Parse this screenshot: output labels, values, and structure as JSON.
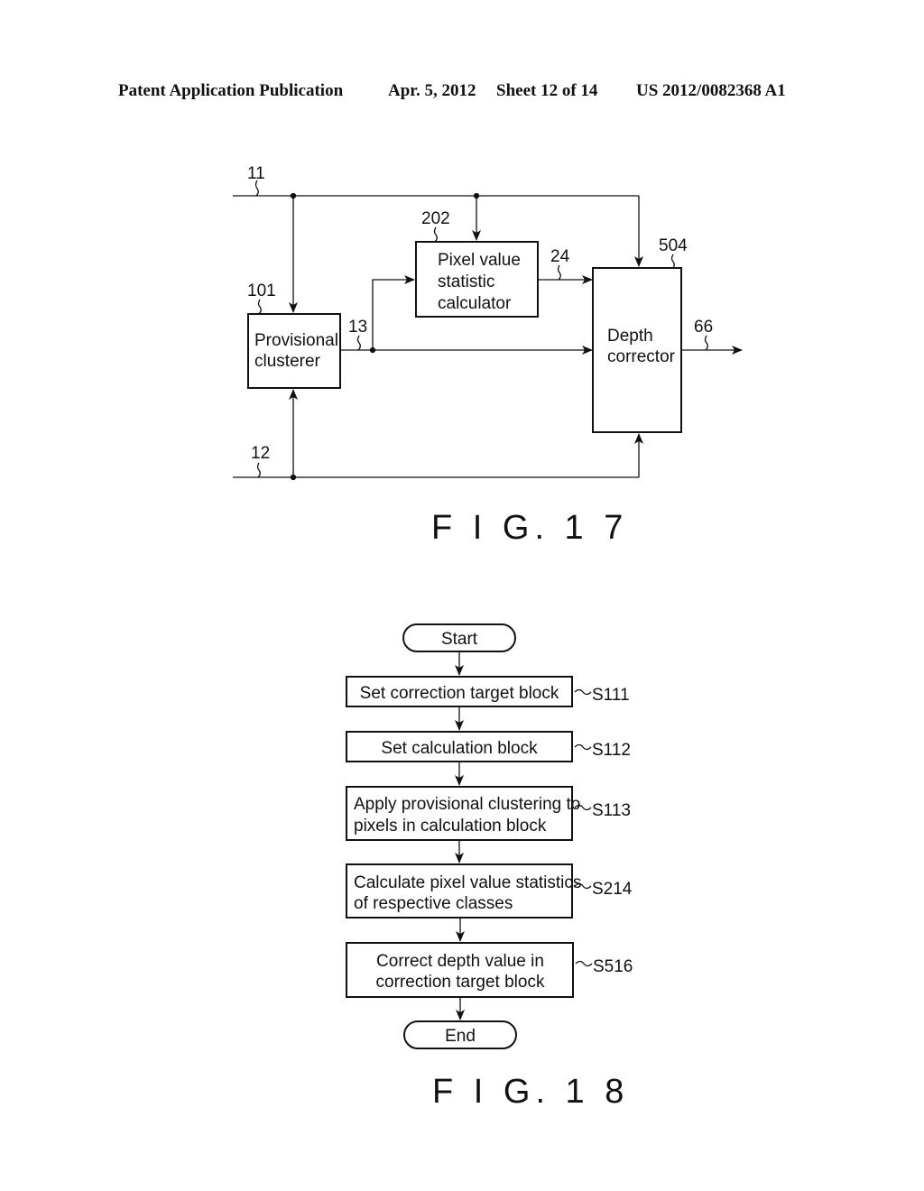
{
  "header": {
    "publication": "Patent Application Publication",
    "date": "Apr. 5, 2012",
    "sheet": "Sheet 12 of 14",
    "number": "US 2012/0082368 A1"
  },
  "fig17": {
    "caption": "F I G. 1 7",
    "signals": {
      "in_top": "11",
      "in_bottom": "12",
      "mid": "13",
      "stat_out": "24",
      "output": "66"
    },
    "blocks": {
      "clusterer": {
        "ref": "101",
        "lines": [
          "Provisional",
          "clusterer"
        ]
      },
      "stat_calc": {
        "ref": "202",
        "lines": [
          "Pixel value",
          "statistic",
          "calculator"
        ]
      },
      "depth_corrector": {
        "ref": "504",
        "lines": [
          "Depth",
          "corrector"
        ]
      }
    }
  },
  "fig18": {
    "caption": "F I G. 1 8",
    "start": "Start",
    "end": "End",
    "steps": [
      {
        "id": "S111",
        "lines": [
          "Set correction target block"
        ]
      },
      {
        "id": "S112",
        "lines": [
          "Set calculation block"
        ]
      },
      {
        "id": "S113",
        "lines": [
          "Apply provisional clustering to",
          "pixels in calculation block"
        ]
      },
      {
        "id": "S214",
        "lines": [
          "Calculate pixel value statistics",
          "of respective classes"
        ]
      },
      {
        "id": "S516",
        "lines": [
          "Correct depth value in",
          "correction target block"
        ]
      }
    ]
  }
}
